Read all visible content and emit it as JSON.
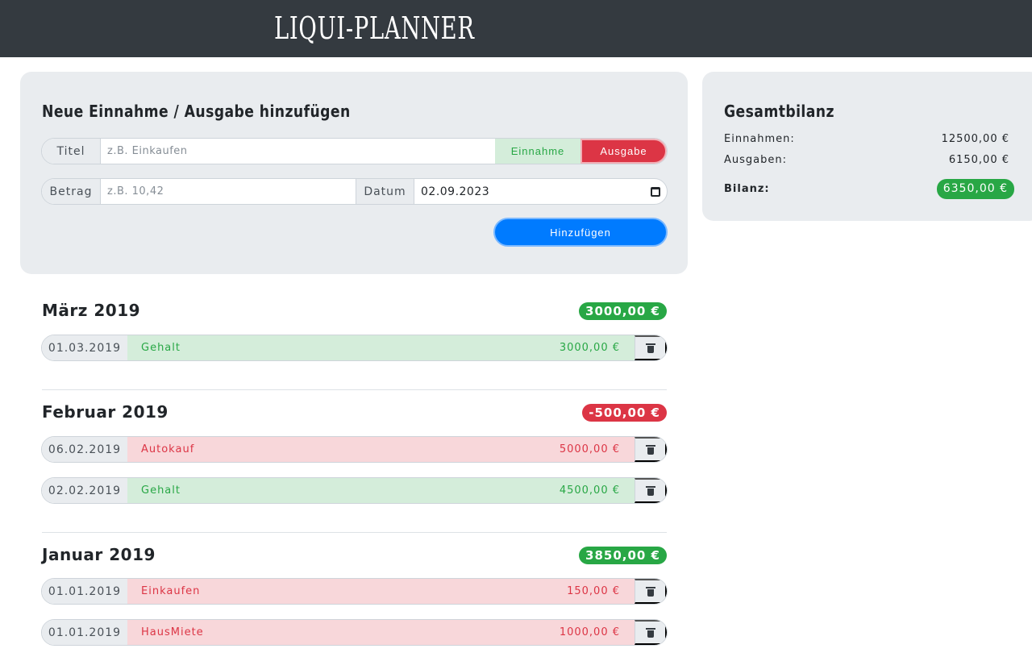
{
  "header": {
    "brand": "LIQUI-PLANNER"
  },
  "form": {
    "title": "Neue Einnahme / Ausgabe hinzufügen",
    "titel_label": "Titel",
    "titel_placeholder": "z.B. Einkaufen",
    "einnahme_label": "Einnahme",
    "ausgabe_label": "Ausgabe",
    "betrag_label": "Betrag",
    "betrag_placeholder": "z.B. 10,42",
    "datum_label": "Datum",
    "datum_value": "02.09.2023",
    "submit_label": "Hinzufügen"
  },
  "summary": {
    "title": "Gesamtbilanz",
    "einnahmen_label": "Einnahmen:",
    "einnahmen_value": "12500,00 €",
    "ausgaben_label": "Ausgaben:",
    "ausgaben_value": "6150,00 €",
    "bilanz_label": "Bilanz:",
    "bilanz_value": "6350,00 €"
  },
  "months": [
    {
      "title": "März 2019",
      "total": "3000,00 €",
      "total_color": "#28a745",
      "entries": [
        {
          "date": "01.03.2019",
          "title": "Gehalt",
          "amount": "3000,00 €",
          "type": "income"
        }
      ]
    },
    {
      "title": "Februar 2019",
      "total": "-500,00 €",
      "total_color": "#dc3545",
      "entries": [
        {
          "date": "06.02.2019",
          "title": "Autokauf",
          "amount": "5000,00 €",
          "type": "expense"
        },
        {
          "date": "02.02.2019",
          "title": "Gehalt",
          "amount": "4500,00 €",
          "type": "income"
        }
      ]
    },
    {
      "title": "Januar 2019",
      "total": "3850,00 €",
      "total_color": "#28a745",
      "entries": [
        {
          "date": "01.01.2019",
          "title": "Einkaufen",
          "amount": "150,00 €",
          "type": "expense"
        },
        {
          "date": "01.01.2019",
          "title": "HausMiete",
          "amount": "1000,00 €",
          "type": "expense"
        }
      ]
    }
  ],
  "icons": {
    "delete": "trash-icon",
    "calendar": "calendar-icon"
  },
  "colors": {
    "income": "#28a745",
    "expense": "#dc3545",
    "primary": "#007bff",
    "header": "#343a40"
  }
}
